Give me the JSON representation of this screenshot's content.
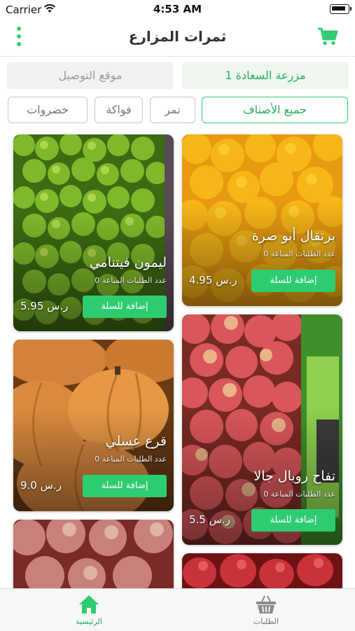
{
  "status": {
    "carrier": "Carrier",
    "time": "4:53 AM"
  },
  "header": {
    "title": "ثمرات المزارع",
    "menu_icon": "more-vertical-icon",
    "cart_icon": "cart-icon"
  },
  "fields": {
    "farm": "مزرعة السعادة 1",
    "location": "موقع التوصيل"
  },
  "categories": [
    "جميع الأصناف",
    "تمر",
    "فواكة",
    "خضروات"
  ],
  "products": [
    {
      "name": "برتقال أبو صرة",
      "orders_label": "عدد الطلبات المباعة 0",
      "price": "4.95 ر.س",
      "add_label": "إضافة للسلة"
    },
    {
      "name": "ليمون فيتنامي",
      "orders_label": "عدد الطلبات المباعة 0",
      "price": "5.95 ر.س",
      "add_label": "إضافة للسلة"
    },
    {
      "name": "تفاح رويال جالا",
      "orders_label": "عدد الطلبات المباعة 0",
      "price": "5.5 ر.س",
      "add_label": "إضافة للسلة"
    },
    {
      "name": "قرع عسلي",
      "orders_label": "عدد الطلبات المباعة 0",
      "price": "9.0 ر.س",
      "add_label": "إضافة للسلة"
    }
  ],
  "tabs": {
    "home": "الرئيسية",
    "orders": "الطلبات"
  },
  "colors": {
    "accent": "#2ecc71",
    "accent_dark": "#27ae60"
  }
}
